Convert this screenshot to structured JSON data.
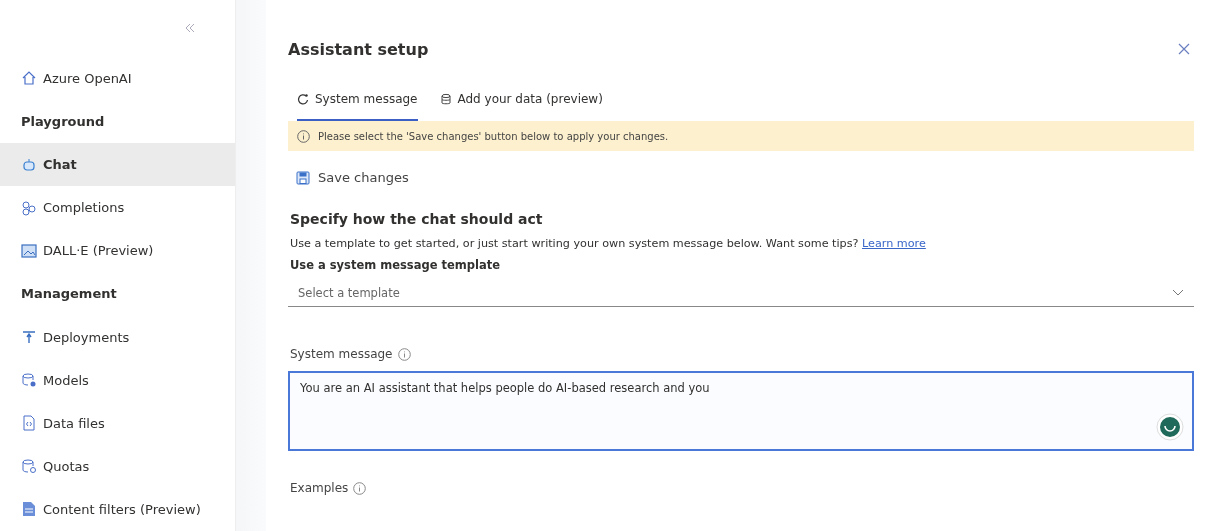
{
  "sidebar": {
    "items": [
      {
        "kind": "link",
        "label": "Azure OpenAI",
        "selected": false
      },
      {
        "kind": "header",
        "label": "Playground"
      },
      {
        "kind": "link",
        "label": "Chat",
        "selected": true
      },
      {
        "kind": "link",
        "label": "Completions",
        "selected": false
      },
      {
        "kind": "link",
        "label": "DALL·E (Preview)",
        "selected": false
      },
      {
        "kind": "header",
        "label": "Management"
      },
      {
        "kind": "link",
        "label": "Deployments",
        "selected": false
      },
      {
        "kind": "link",
        "label": "Models",
        "selected": false
      },
      {
        "kind": "link",
        "label": "Data files",
        "selected": false
      },
      {
        "kind": "link",
        "label": "Quotas",
        "selected": false
      },
      {
        "kind": "link",
        "label": "Content filters (Preview)",
        "selected": false
      }
    ]
  },
  "panel": {
    "title": "Assistant setup",
    "tabs": [
      {
        "label": "System message",
        "selected": true
      },
      {
        "label": "Add your data (preview)",
        "selected": false
      }
    ],
    "notice": "Please select the 'Save changes' button below to apply your changes.",
    "save_button": "Save changes",
    "heading": "Specify how the chat should act",
    "description": "Use a template to get started, or just start writing your own system message below. Want some tips?",
    "learn_more": "Learn more",
    "template_label": "Use a system message template",
    "template_select": {
      "placeholder": "Select a template"
    },
    "system_message_label": "System message",
    "system_message": {
      "value": "You are an AI assistant that helps people do AI-based research and you"
    },
    "examples_label": "Examples"
  }
}
